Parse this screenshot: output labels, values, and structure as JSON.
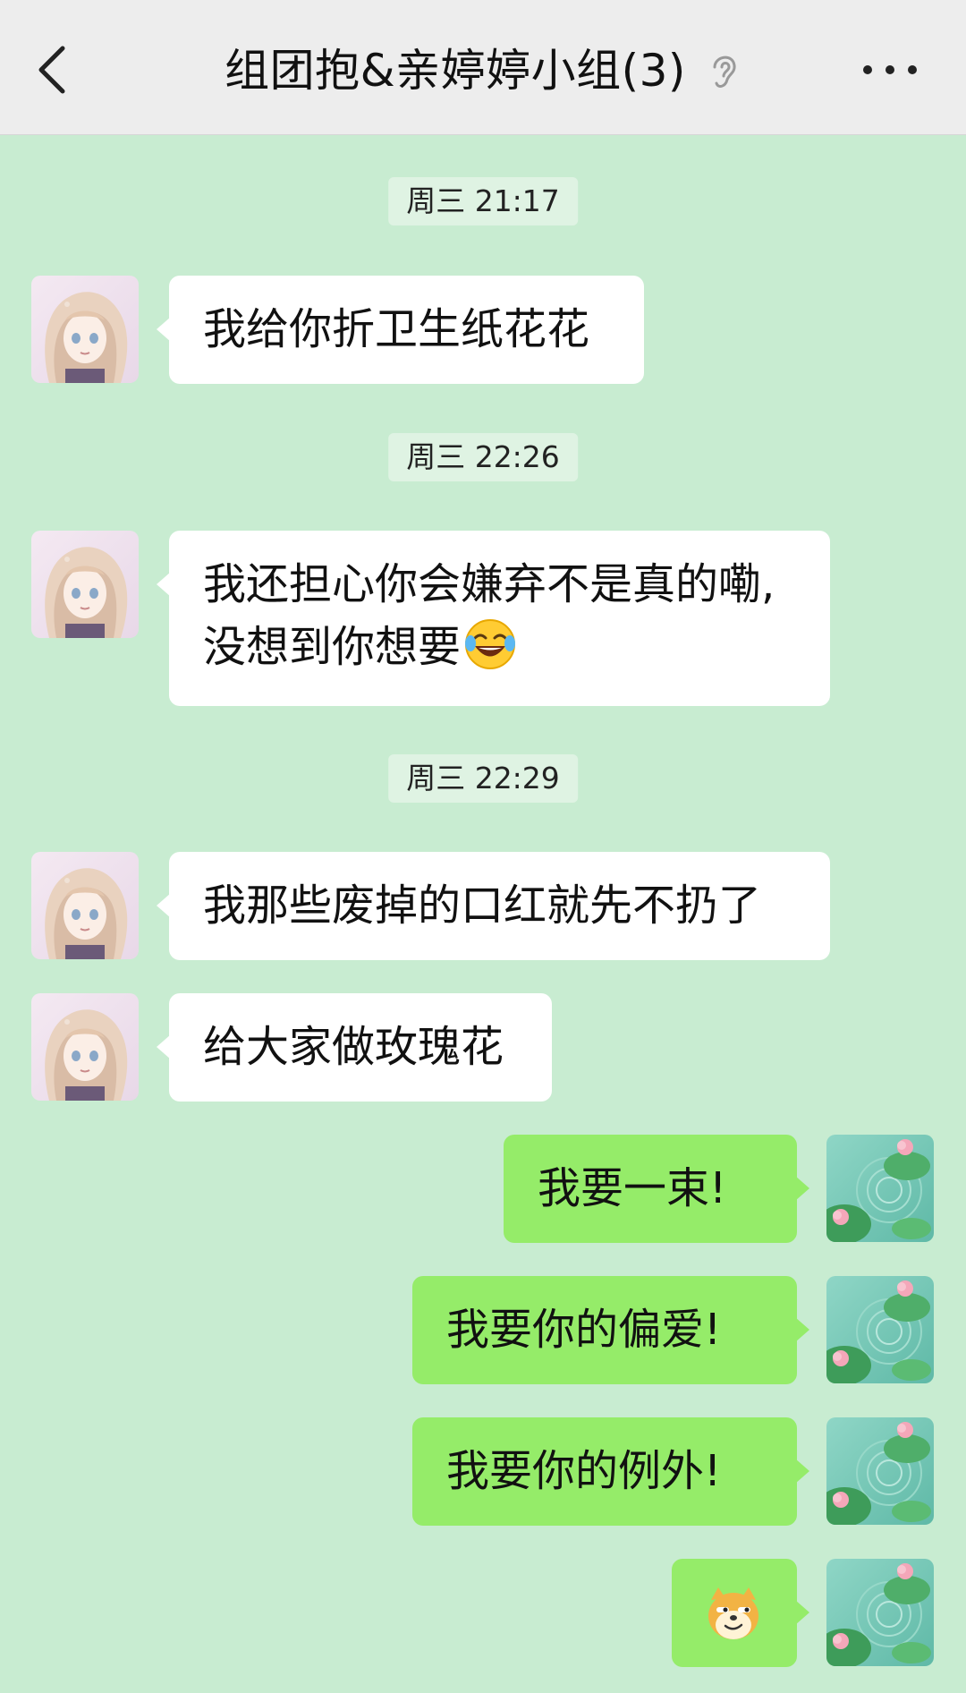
{
  "header": {
    "title": "组团抱&亲婷婷小组(3)",
    "back_icon": "chevron-left-icon",
    "mute_icon": "ear-icon",
    "more_icon": "more-dots-icon"
  },
  "timestamps": [
    "周三 21:17",
    "周三 22:26",
    "周三 22:29"
  ],
  "messages": [
    {
      "direction": "in",
      "text": "我给你折卫生纸花花"
    },
    {
      "direction": "in",
      "line1": "我还担心你会嫌弃不是真的嘞,",
      "line2": "没想到你想要",
      "emoji": "laughing-tears-emoji"
    },
    {
      "direction": "in",
      "text": "我那些废掉的口红就先不扔了"
    },
    {
      "direction": "in",
      "text": "给大家做玫瑰花"
    },
    {
      "direction": "out",
      "text": "我要一束!"
    },
    {
      "direction": "out",
      "text": "我要你的偏爱!"
    },
    {
      "direction": "out",
      "text": "我要你的例外!"
    },
    {
      "direction": "out",
      "emoji": "smirk-dog-emoji"
    }
  ],
  "colors": {
    "background": "#c8ecd1",
    "header": "#ededed",
    "incoming_bubble": "#ffffff",
    "outgoing_bubble": "#95ec69"
  }
}
